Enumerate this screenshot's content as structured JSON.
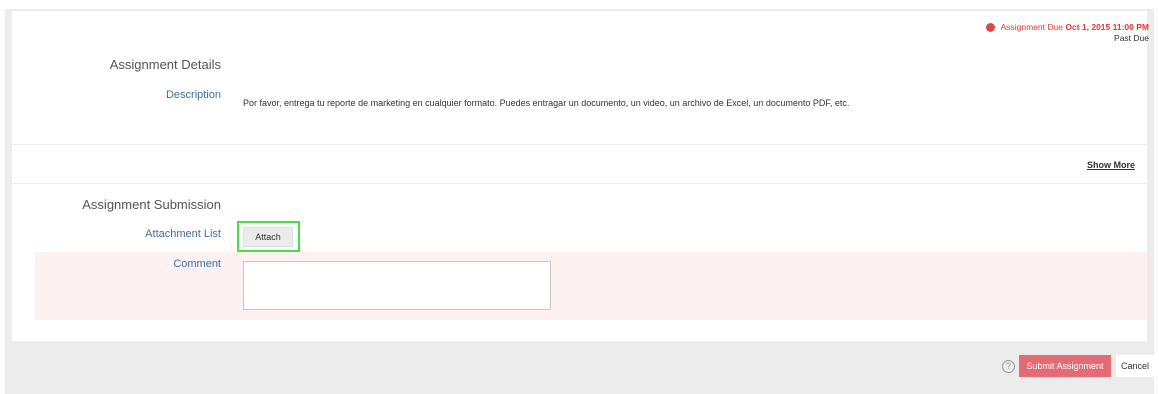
{
  "due": {
    "label": "Assignment Due",
    "date": "Oct 1, 2015 11:00 PM",
    "status": "Past Due",
    "dot_color": "#e04848"
  },
  "details": {
    "title": "Assignment Details",
    "description_label": "Description",
    "description_text": "Por favor, entrega tu reporte de marketing en cualquier formato. Puedes entragar un documento, un video, un archivo de Excel, un documento PDF, etc."
  },
  "show_more": "Show More",
  "submission": {
    "title": "Assignment Submission",
    "attachment_label": "Attachment List",
    "attach_button": "Attach",
    "comment_label": "Comment",
    "comment_value": ""
  },
  "footer": {
    "help_icon": "?",
    "submit_button": "Submit Assignment",
    "cancel_button": "Cancel"
  },
  "colors": {
    "accent": "#e36c74",
    "due_red": "#e53935",
    "label_blue": "#3d6fa8",
    "highlight_green": "#4cdd44"
  }
}
